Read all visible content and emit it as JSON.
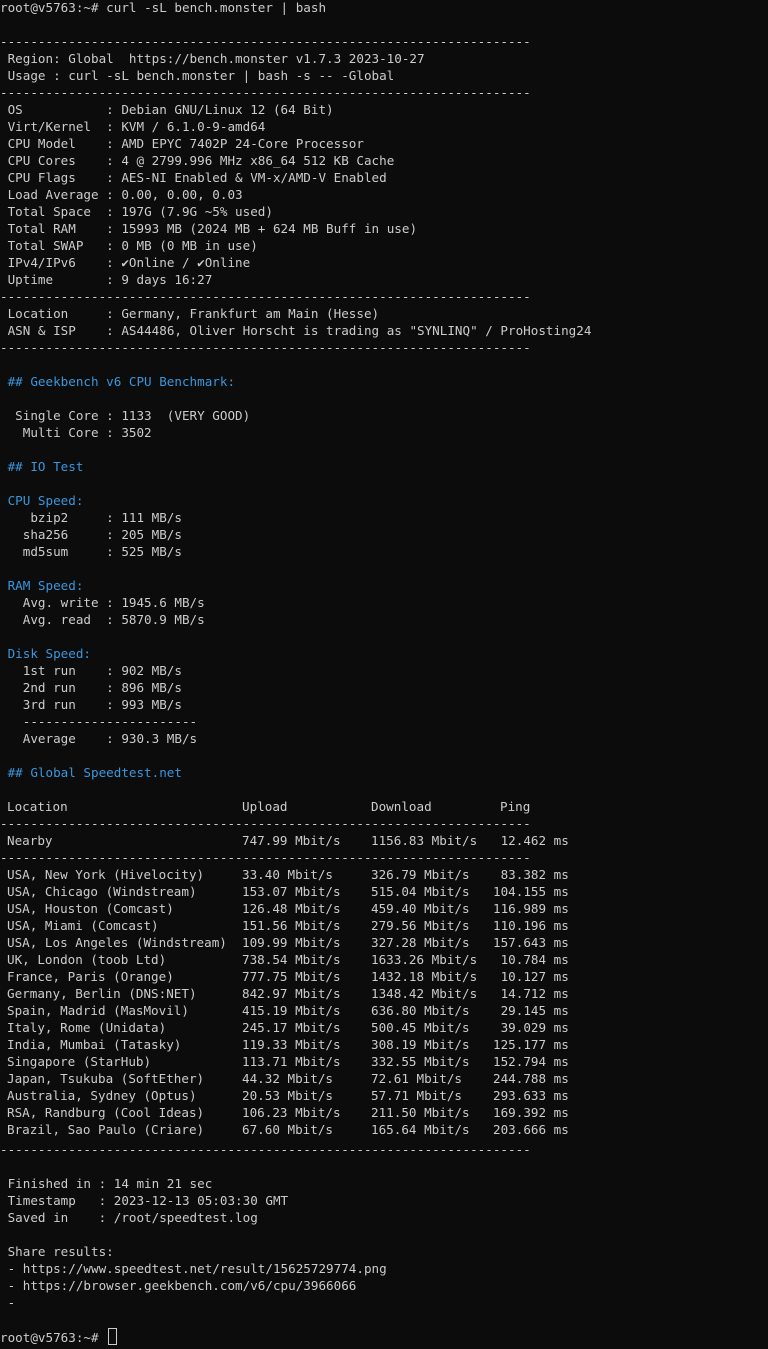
{
  "terminal": {
    "prompt": "root@v5763:~#",
    "command": " curl -sL bench.monster | bash",
    "separator_long": "----------------------------------------------------------------------",
    "separator_short": "----------------------"
  },
  "header": {
    "region_line": " Region: Global  https://bench.monster v1.7.3 2023-10-27",
    "usage_line": " Usage : curl -sL bench.monster | bash -s -- -Global"
  },
  "system_info": [
    {
      "label": " OS           ",
      "value": ": Debian GNU/Linux 12 (64 Bit)"
    },
    {
      "label": " Virt/Kernel  ",
      "value": ": KVM / 6.1.0-9-amd64"
    },
    {
      "label": " CPU Model    ",
      "value": ": AMD EPYC 7402P 24-Core Processor"
    },
    {
      "label": " CPU Cores    ",
      "value": ": 4 @ 2799.996 MHz x86_64 512 KB Cache"
    },
    {
      "label": " CPU Flags    ",
      "value": ": AES-NI Enabled & VM-x/AMD-V Enabled"
    },
    {
      "label": " Load Average ",
      "value": ": 0.00, 0.00, 0.03"
    },
    {
      "label": " Total Space  ",
      "value": ": 197G (7.9G ~5% used)"
    },
    {
      "label": " Total RAM    ",
      "value": ": 15993 MB (2024 MB + 624 MB Buff in use)"
    },
    {
      "label": " Total SWAP   ",
      "value": ": 0 MB (0 MB in use)"
    },
    {
      "label": " IPv4/IPv6    ",
      "value": ": ✔Online / ✔Online"
    },
    {
      "label": " Uptime       ",
      "value": ": 9 days 16:27"
    }
  ],
  "location_info": [
    {
      "label": " Location     ",
      "value": ": Germany, Frankfurt am Main (Hesse)"
    },
    {
      "label": " ASN & ISP    ",
      "value": ": AS44486, Oliver Horscht is trading as \"SYNLINQ\" / ProHosting24"
    }
  ],
  "geekbench": {
    "heading": " ## Geekbench v6 CPU Benchmark:",
    "single": "  Single Core : 1133  (VERY GOOD)",
    "multi": "   Multi Core : 3502"
  },
  "io_test": {
    "heading": " ## IO Test",
    "cpu_heading": " CPU Speed:",
    "cpu_rows": [
      "    bzip2     : 111 MB/s",
      "   sha256     : 205 MB/s",
      "   md5sum     : 525 MB/s"
    ],
    "ram_heading": " RAM Speed:",
    "ram_rows": [
      "   Avg. write : 1945.6 MB/s",
      "   Avg. read  : 5870.9 MB/s"
    ],
    "disk_heading": " Disk Speed:",
    "disk_rows": [
      "   1st run    : 902 MB/s",
      "   2nd run    : 896 MB/s",
      "   3rd run    : 993 MB/s"
    ],
    "disk_separator": "   -----------------------",
    "disk_average": "   Average    : 930.3 MB/s"
  },
  "speedtest": {
    "heading": " ## Global Speedtest.net",
    "columns": [
      "Location",
      "Upload",
      "Download",
      "Ping"
    ],
    "nearby": {
      "location": "Nearby",
      "upload": "747.99 Mbit/s",
      "download": "1156.83 Mbit/s",
      "ping": " 12.462 ms"
    },
    "rows": [
      {
        "location": "USA, New York (Hivelocity)",
        "upload": "33.40 Mbit/s",
        "download": "326.79 Mbit/s",
        "ping": " 83.382 ms"
      },
      {
        "location": "USA, Chicago (Windstream)",
        "upload": "153.07 Mbit/s",
        "download": "515.04 Mbit/s",
        "ping": "104.155 ms"
      },
      {
        "location": "USA, Houston (Comcast)",
        "upload": "126.48 Mbit/s",
        "download": "459.40 Mbit/s",
        "ping": "116.989 ms"
      },
      {
        "location": "USA, Miami (Comcast)",
        "upload": "151.56 Mbit/s",
        "download": "279.56 Mbit/s",
        "ping": "110.196 ms"
      },
      {
        "location": "USA, Los Angeles (Windstream)",
        "upload": "109.99 Mbit/s",
        "download": "327.28 Mbit/s",
        "ping": "157.643 ms"
      },
      {
        "location": "UK, London (toob Ltd)",
        "upload": "738.54 Mbit/s",
        "download": "1633.26 Mbit/s",
        "ping": " 10.784 ms"
      },
      {
        "location": "France, Paris (Orange)",
        "upload": "777.75 Mbit/s",
        "download": "1432.18 Mbit/s",
        "ping": " 10.127 ms"
      },
      {
        "location": "Germany, Berlin (DNS:NET)",
        "upload": "842.97 Mbit/s",
        "download": "1348.42 Mbit/s",
        "ping": " 14.712 ms"
      },
      {
        "location": "Spain, Madrid (MasMovil)",
        "upload": "415.19 Mbit/s",
        "download": "636.80 Mbit/s",
        "ping": " 29.145 ms"
      },
      {
        "location": "Italy, Rome (Unidata)",
        "upload": "245.17 Mbit/s",
        "download": "500.45 Mbit/s",
        "ping": " 39.029 ms"
      },
      {
        "location": "India, Mumbai (Tatasky)",
        "upload": "119.33 Mbit/s",
        "download": "308.19 Mbit/s",
        "ping": "125.177 ms"
      },
      {
        "location": "Singapore (StarHub)",
        "upload": "113.71 Mbit/s",
        "download": "332.55 Mbit/s",
        "ping": "152.794 ms"
      },
      {
        "location": "Japan, Tsukuba (SoftEther)",
        "upload": "44.32 Mbit/s",
        "download": "72.61 Mbit/s",
        "ping": "244.788 ms"
      },
      {
        "location": "Australia, Sydney (Optus)",
        "upload": "20.53 Mbit/s",
        "download": "57.71 Mbit/s",
        "ping": "293.633 ms"
      },
      {
        "location": "RSA, Randburg (Cool Ideas)",
        "upload": "106.23 Mbit/s",
        "download": "211.50 Mbit/s",
        "ping": "169.392 ms"
      },
      {
        "location": "Brazil, Sao Paulo (Criare)",
        "upload": "67.60 Mbit/s",
        "download": "165.64 Mbit/s",
        "ping": "203.666 ms"
      }
    ]
  },
  "summary": {
    "finished": " Finished in : 14 min 21 sec",
    "timestamp": " Timestamp   : 2023-12-13 05:03:30 GMT",
    "saved": " Saved in    : /root/speedtest.log",
    "share_heading": " Share results:",
    "share_links": [
      " - https://www.speedtest.net/result/15625729774.png",
      " - https://browser.geekbench.com/v6/cpu/3966066",
      " -"
    ]
  }
}
